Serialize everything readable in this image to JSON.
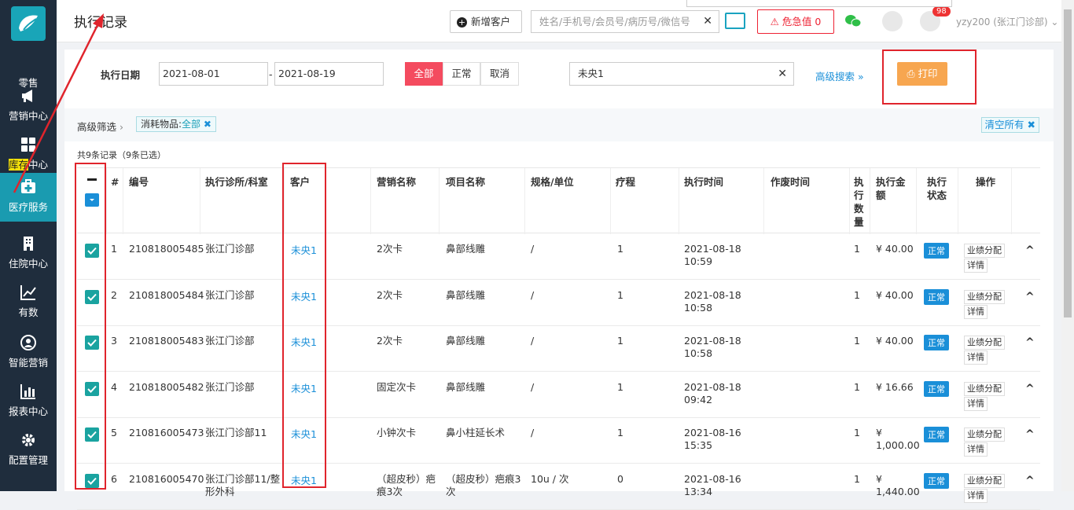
{
  "app": {
    "page_title": "执行记录"
  },
  "sidebar": {
    "items": [
      {
        "label": "零售",
        "icon": "retail-icon"
      },
      {
        "label": "营销中心",
        "icon": "megaphone-icon"
      },
      {
        "label_hi": "库存",
        "label_rest": "中心",
        "icon": "grid-icon"
      },
      {
        "label": "医疗服务",
        "icon": "medical-kit-icon"
      },
      {
        "label": "住院中心",
        "icon": "building-icon"
      },
      {
        "label": "有数",
        "icon": "trend-chart-icon"
      },
      {
        "label": "智能营销",
        "icon": "smart-marketing-icon"
      },
      {
        "label": "报表中心",
        "icon": "bar-chart-icon"
      },
      {
        "label": "配置管理",
        "icon": "gear-icon"
      }
    ]
  },
  "topbar": {
    "add_customer": "新增客户",
    "search_placeholder": "姓名/手机号/会员号/病历号/微信号",
    "danger_label": "危急值",
    "danger_count": "0",
    "bell_badge": "98",
    "user": "yzy200 (张江门诊部)"
  },
  "filters": {
    "date_label": "执行日期",
    "date_from": "2021-08-01",
    "date_to": "2021-08-19",
    "date_sep": "-",
    "segments": [
      "全部",
      "正常",
      "取消"
    ],
    "customer_value": "未央1",
    "advanced_search": "高级搜索",
    "print": "打印"
  },
  "filter_bar": {
    "label": "高级筛选",
    "chip_key": "消耗物品:",
    "chip_val": "全部",
    "clear_all": "清空所有"
  },
  "record_count": "共9条记录（9条已选）",
  "table": {
    "headers": {
      "num": "#",
      "code": "编号",
      "clinic": "执行诊所/科室",
      "customer": "客户",
      "marketing": "营销名称",
      "item": "项目名称",
      "spec": "规格/单位",
      "course": "疗程",
      "exec_time": "执行时间",
      "void_time": "作废时间",
      "qty": "执行数量",
      "amount": "执行金额",
      "status": "执行状态",
      "ops": "操作"
    },
    "rows": [
      {
        "n": "1",
        "code": "210818005485",
        "clinic": "张江门诊部",
        "customer": "未央1",
        "marketing": "2次卡",
        "item": "鼻部线雕",
        "spec": "/",
        "course": "1",
        "date": "2021-08-18",
        "time": "10:59",
        "qty": "1",
        "amount": "¥ 40.00",
        "amount2": "",
        "status": "正常"
      },
      {
        "n": "2",
        "code": "210818005484",
        "clinic": "张江门诊部",
        "customer": "未央1",
        "marketing": "2次卡",
        "item": "鼻部线雕",
        "spec": "/",
        "course": "1",
        "date": "2021-08-18",
        "time": "10:58",
        "qty": "1",
        "amount": "¥ 40.00",
        "amount2": "",
        "status": "正常"
      },
      {
        "n": "3",
        "code": "210818005483",
        "clinic": "张江门诊部",
        "customer": "未央1",
        "marketing": "2次卡",
        "item": "鼻部线雕",
        "spec": "/",
        "course": "1",
        "date": "2021-08-18",
        "time": "10:58",
        "qty": "1",
        "amount": "¥ 40.00",
        "amount2": "",
        "status": "正常"
      },
      {
        "n": "4",
        "code": "210818005482",
        "clinic": "张江门诊部",
        "customer": "未央1",
        "marketing": "固定次卡",
        "item": "鼻部线雕",
        "spec": "/",
        "course": "1",
        "date": "2021-08-18",
        "time": "09:42",
        "qty": "1",
        "amount": "¥ 16.66",
        "amount2": "",
        "status": "正常"
      },
      {
        "n": "5",
        "code": "210816005473",
        "clinic": "张江门诊部11",
        "customer": "未央1",
        "marketing": "小钟次卡",
        "item": "鼻小柱延长术",
        "spec": "/",
        "course": "1",
        "date": "2021-08-16",
        "time": "15:35",
        "qty": "1",
        "amount": "¥",
        "amount2": "1,000.00",
        "status": "正常"
      },
      {
        "n": "6",
        "code": "210816005470",
        "clinic": "张江门诊部11/整形外科",
        "customer": "未央1",
        "marketing": "（超皮秒）疤痕3次",
        "item": "（超皮秒）疤痕3次",
        "spec": "10u / 次",
        "course": "0",
        "date": "2021-08-16",
        "time": "13:34",
        "qty": "1",
        "amount": "¥",
        "amount2": "1,440.00",
        "status": "正常"
      }
    ],
    "op_labels": [
      "业绩分配",
      "详情"
    ]
  }
}
